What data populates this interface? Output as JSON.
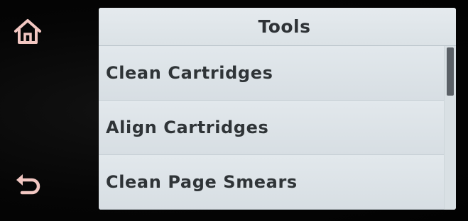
{
  "header": {
    "title": "Tools"
  },
  "menu": {
    "items": [
      {
        "label": "Clean Cartridges"
      },
      {
        "label": "Align Cartridges"
      },
      {
        "label": "Clean Page Smears"
      }
    ],
    "scroll_position": 0
  },
  "buttons": {
    "home_icon": "home-icon",
    "back_icon": "back-arrow-icon"
  },
  "colors": {
    "screen_bg": "#dfe6ea",
    "text": "#2f3437",
    "button_glyph": "#f2c7c2",
    "scroll_thumb": "#5a6066"
  }
}
